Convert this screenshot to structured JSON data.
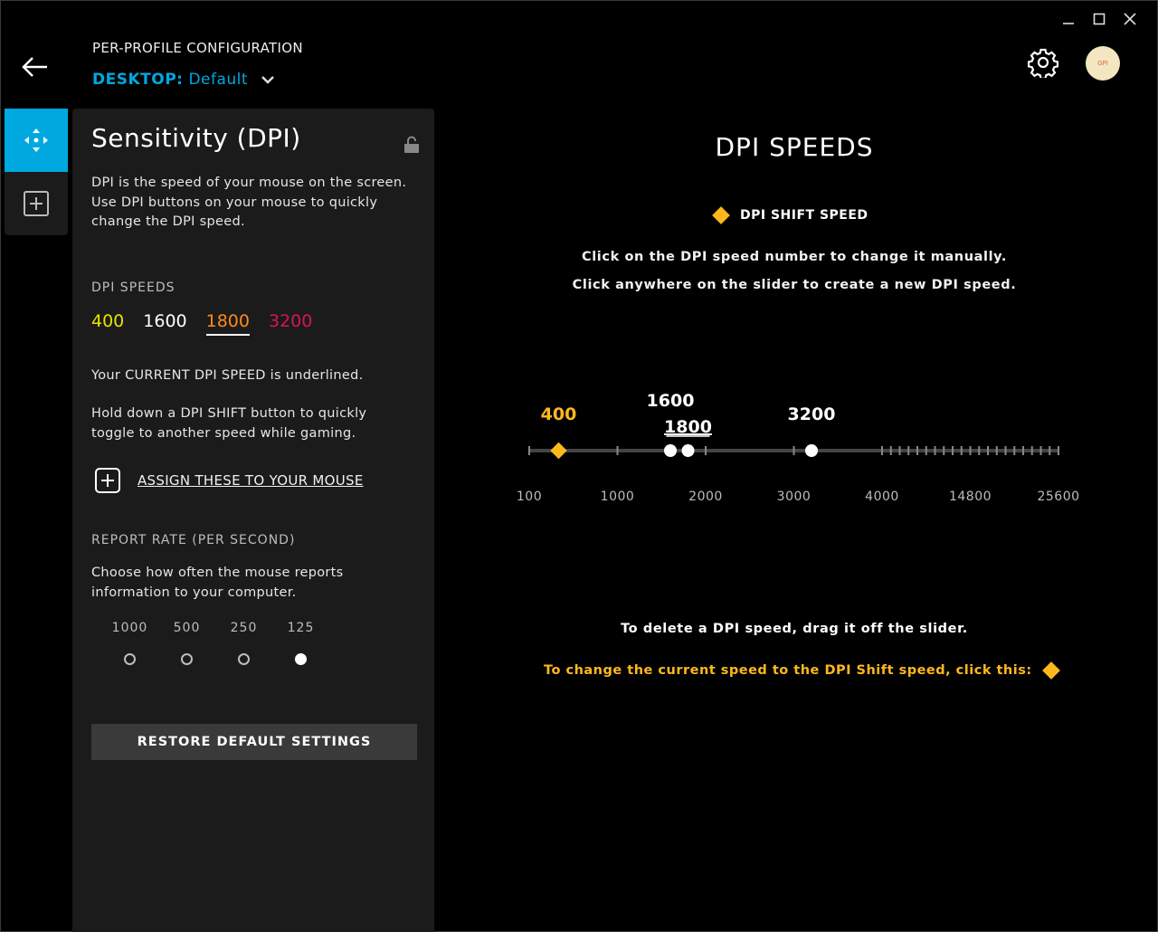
{
  "window": {
    "minimize": "—",
    "maximize": "☐",
    "close": "✕"
  },
  "header": {
    "title": "PER-PROFILE CONFIGURATION",
    "profile_prefix": "DESKTOP:",
    "profile_name": "Default",
    "avatar_text": "GPI"
  },
  "panel": {
    "title": "Sensitivity (DPI)",
    "description": "DPI is the speed of your mouse on the screen. Use DPI buttons on your mouse to quickly change the DPI speed.",
    "dpi_section": "DPI SPEEDS",
    "dpi_speeds": [
      {
        "value": "400",
        "color": "#e8e000"
      },
      {
        "value": "1600",
        "color": "#ffffff"
      },
      {
        "value": "1800",
        "color": "#ff8a1c",
        "current": true
      },
      {
        "value": "3200",
        "color": "#d6145e"
      }
    ],
    "current_note": "Your CURRENT DPI SPEED is underlined.",
    "shift_note": "Hold down a DPI SHIFT button to quickly toggle to another speed while gaming.",
    "assign_label": "ASSIGN THESE TO YOUR MOUSE",
    "report_section": "REPORT RATE (PER SECOND)",
    "report_desc": "Choose how often the mouse reports information to your computer.",
    "report_rates": [
      {
        "value": "1000",
        "selected": false
      },
      {
        "value": "500",
        "selected": false
      },
      {
        "value": "250",
        "selected": false
      },
      {
        "value": "125",
        "selected": true
      }
    ],
    "restore_label": "RESTORE DEFAULT SETTINGS"
  },
  "main": {
    "title": "DPI SPEEDS",
    "shift_legend": "DPI SHIFT SPEED",
    "info1": "Click on the DPI speed number to change it manually.",
    "info2": "Click anywhere on the slider to create a new DPI speed.",
    "delete_info": "To delete a DPI speed, drag it off the slider.",
    "shift_cta": "To change the current speed to the DPI Shift speed, click this:",
    "slider": {
      "scale_labels": [
        "100",
        "1000",
        "2000",
        "3000",
        "4000",
        "14800",
        "25600"
      ],
      "shift_value": "400",
      "points": [
        {
          "value": "1600",
          "current": false
        },
        {
          "value": "1800",
          "current": true
        },
        {
          "value": "3200",
          "current": false
        }
      ],
      "accent": "#ffb81c"
    }
  }
}
